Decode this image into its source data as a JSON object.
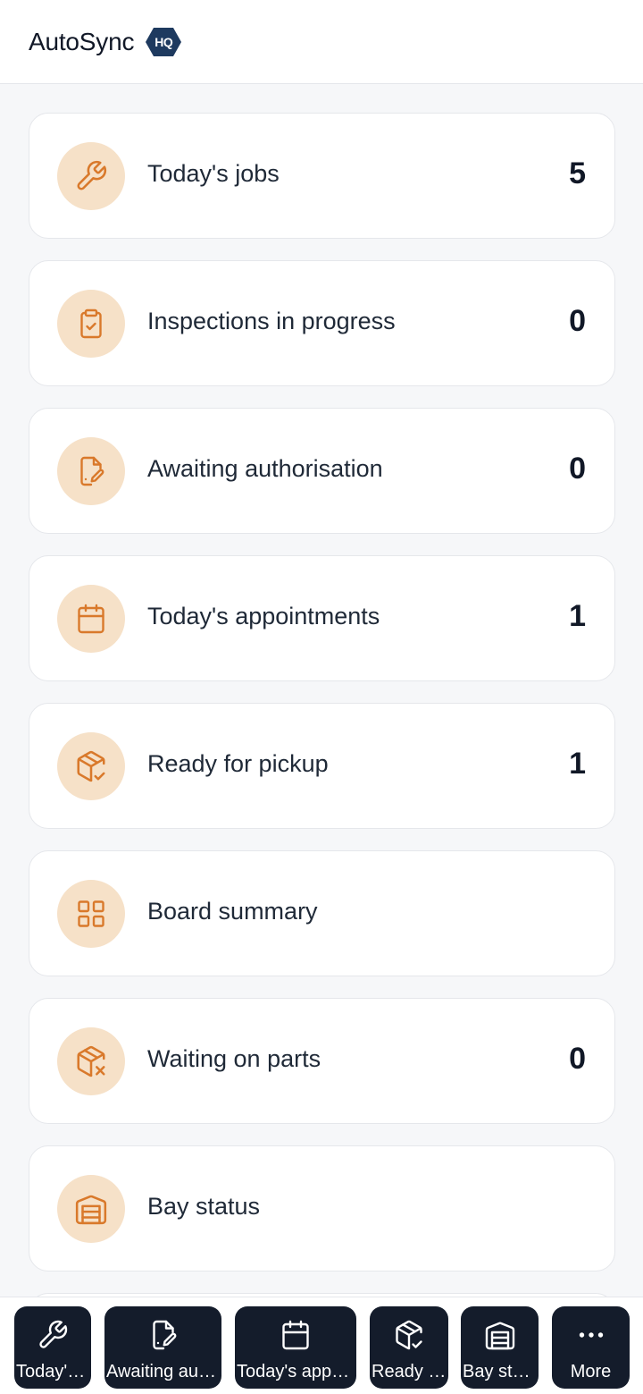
{
  "header": {
    "app_name": "AutoSync",
    "badge": "HQ"
  },
  "cards": [
    {
      "icon": "wrench-icon",
      "label": "Today's jobs",
      "count": "5"
    },
    {
      "icon": "clipboard-check-icon",
      "label": "Inspections in progress",
      "count": "0"
    },
    {
      "icon": "file-signature-icon",
      "label": "Awaiting authorisation",
      "count": "0"
    },
    {
      "icon": "calendar-icon",
      "label": "Today's appointments",
      "count": "1"
    },
    {
      "icon": "package-check-icon",
      "label": "Ready for pickup",
      "count": "1"
    },
    {
      "icon": "grid-icon",
      "label": "Board summary",
      "count": ""
    },
    {
      "icon": "package-x-icon",
      "label": "Waiting on parts",
      "count": "0"
    },
    {
      "icon": "garage-icon",
      "label": "Bay status",
      "count": ""
    }
  ],
  "bottom_nav": [
    {
      "icon": "wrench-icon",
      "label": "Today's jobs"
    },
    {
      "icon": "file-signature-icon",
      "label": "Awaiting authorisation"
    },
    {
      "icon": "calendar-icon",
      "label": "Today's appointments"
    },
    {
      "icon": "package-check-icon",
      "label": "Ready for pickup"
    },
    {
      "icon": "garage-icon",
      "label": "Bay status"
    },
    {
      "icon": "more-horizontal-icon",
      "label": "More"
    }
  ],
  "colors": {
    "accent": "#d9792b",
    "accent_bg": "#f6e1c8",
    "nav_bg": "#141c2b",
    "badge_bg": "#1e3a5f"
  }
}
